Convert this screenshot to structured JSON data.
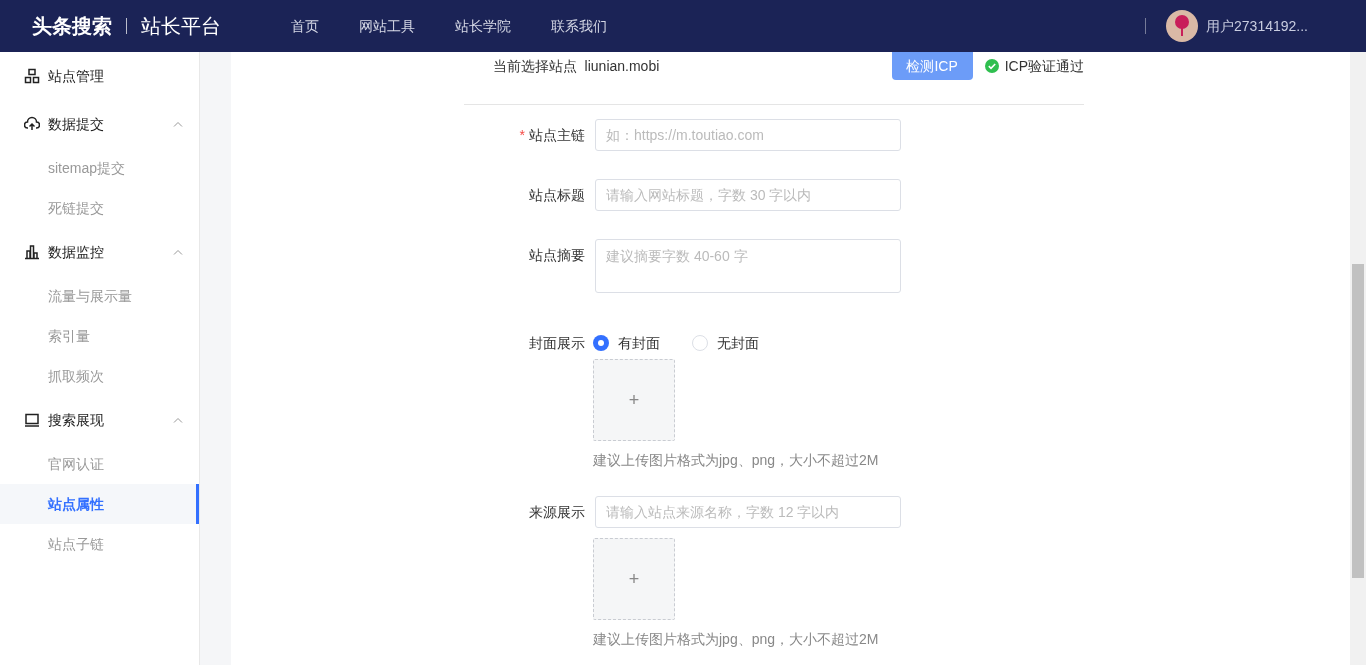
{
  "header": {
    "brand": "头条搜索",
    "product": "站长平台",
    "nav": [
      {
        "label": "首页"
      },
      {
        "label": "网站工具"
      },
      {
        "label": "站长学院"
      },
      {
        "label": "联系我们"
      }
    ],
    "user": {
      "name": "用户27314192..."
    }
  },
  "sidebar": {
    "items": [
      {
        "label": "站点管理",
        "selected": false
      },
      {
        "label": "数据提交",
        "selected": false,
        "expanded": true,
        "children": [
          {
            "label": "sitemap提交",
            "selected": false
          },
          {
            "label": "死链提交",
            "selected": false
          }
        ]
      },
      {
        "label": "数据监控",
        "selected": false,
        "expanded": true,
        "children": [
          {
            "label": "流量与展示量",
            "selected": false
          },
          {
            "label": "索引量",
            "selected": false
          },
          {
            "label": "抓取频次",
            "selected": false
          }
        ]
      },
      {
        "label": "搜索展现",
        "selected": false,
        "expanded": true,
        "children": [
          {
            "label": "官网认证",
            "selected": false
          },
          {
            "label": "站点属性",
            "selected": true
          },
          {
            "label": "站点子链",
            "selected": false
          }
        ]
      }
    ]
  },
  "form": {
    "site_label": "当前选择站点",
    "site_value": "liunian.mobi",
    "check_button": "检测ICP",
    "icp_status": "ICP验证通过",
    "fields": [
      {
        "kind": "input",
        "label": "站点主链",
        "required_mark": "*",
        "placeholder": "如：https://m.toutiao.com"
      },
      {
        "kind": "input",
        "label": "站点标题",
        "placeholder": "请输入网站标题，字数 30 字以内"
      },
      {
        "kind": "textarea",
        "label": "站点摘要",
        "placeholder": "建议摘要字数 40-60 字"
      },
      {
        "kind": "upload",
        "label": "封面展示",
        "options": [
          {
            "label": "有封面",
            "selected": true
          },
          {
            "label": "无封面",
            "selected": false
          }
        ],
        "upload_glyph": "+",
        "hint": "建议上传图片格式为jpg、png，大小不超过2M"
      },
      {
        "kind": "upload",
        "label": "来源展示",
        "placeholder": "请输入站点来源名称，字数 12 字以内",
        "upload_glyph": "+",
        "hint": "建议上传图片格式为jpg、png，大小不超过2M"
      }
    ]
  }
}
